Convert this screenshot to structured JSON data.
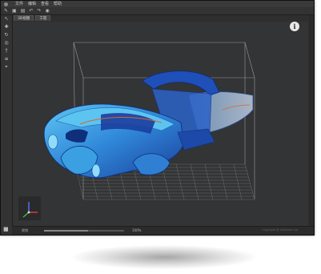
{
  "menu": {
    "items": [
      "文件",
      "编辑",
      "查看",
      "帮助"
    ]
  },
  "toolbar": {
    "icons": [
      "open-icon",
      "save-icon",
      "print-icon",
      "undo-icon",
      "redo-icon",
      "eye-icon"
    ]
  },
  "tabs": [
    {
      "label": "3D视图"
    },
    {
      "label": "工程"
    }
  ],
  "left_tools": [
    "select-icon",
    "move-icon",
    "rotate-icon",
    "scale-icon",
    "pin-icon",
    "layers-icon",
    "measure-icon"
  ],
  "viewport": {
    "info_label": "i"
  },
  "status": {
    "left_text": "就绪",
    "progress_fraction": 0.55,
    "mid_text": "100%",
    "right_text": "Copyright @ Software Ltd"
  },
  "colors": {
    "frame": "#2e2e2e",
    "viewport_bg": "#333435",
    "model_blue": "#2f6fd6",
    "model_cyan": "#46a6e6",
    "grid": "#7a7a7a"
  }
}
